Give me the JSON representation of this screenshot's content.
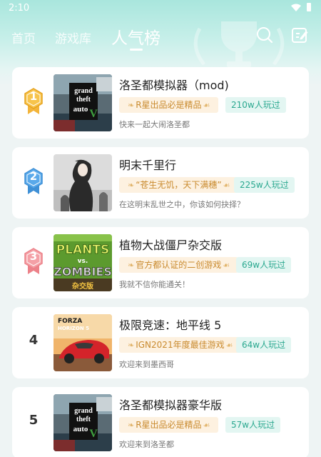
{
  "status_bar": {
    "time": "2:10"
  },
  "nav": {
    "tabs": [
      {
        "label": "首页"
      },
      {
        "label": "游戏库"
      },
      {
        "label": "人气榜",
        "active": true
      }
    ],
    "icons": [
      "search-icon",
      "edit-icon"
    ]
  },
  "colors": {
    "accent": "#2aa88f",
    "header_gradient_top": "#a9e6dd",
    "honor_tag_bg": "#fdf1e0",
    "honor_tag_text": "#c98a2e",
    "plays_tag_bg": "#e3f6f2",
    "gold": "#f3b43a",
    "silver_blue": "#4a9fe2",
    "bronze_pink": "#ef8f95"
  },
  "games": [
    {
      "rank": "1",
      "badge": "gold",
      "title": "洛圣都模拟器（mod)",
      "honor": "R星出品必是精品",
      "plays": "210w人玩过",
      "desc": "快来一起大闹洛圣都"
    },
    {
      "rank": "2",
      "badge": "silver",
      "title": "明末千里行",
      "honor": "“苍生无饥，天下满穗”",
      "plays": "225w人玩过",
      "desc": "在这明末乱世之中，你该如何抉择？"
    },
    {
      "rank": "3",
      "badge": "bronze",
      "title": "植物大战僵尸杂交版",
      "honor": "官方都认证的二创游戏",
      "plays": "69w人玩过",
      "desc": "我就不信你能通关！"
    },
    {
      "rank": "4",
      "badge": "none",
      "title": "极限竞速：地平线 5",
      "honor": "IGN2021年度最佳游戏",
      "plays": "64w人玩过",
      "desc": "欢迎来到墨西哥"
    },
    {
      "rank": "5",
      "badge": "none",
      "title": "洛圣都模拟器豪华版",
      "honor": "R星出品必是精品",
      "plays": "57w人玩过",
      "desc": "欢迎来到洛圣都"
    }
  ],
  "thumb_art": {
    "gta": {
      "line1": "grand",
      "line2": "theft",
      "line3": "auto",
      "mark": "V"
    },
    "pvz": {
      "line1": "PLANTS",
      "line2": "vs.",
      "line3": "ZOMBIES",
      "sub": "杂交版"
    },
    "forza": {
      "line1": "FORZA",
      "line2": "HORIZON 5"
    }
  }
}
